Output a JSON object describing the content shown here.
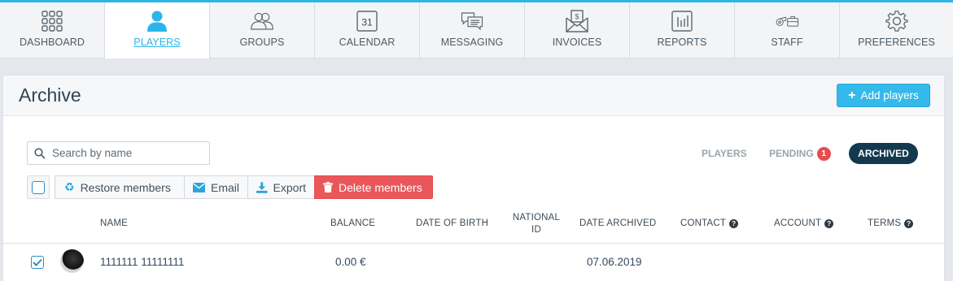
{
  "nav": {
    "items": [
      {
        "label": "DASHBOARD",
        "icon": "dashboard-grid-icon"
      },
      {
        "label": "PLAYERS",
        "icon": "player-person-icon",
        "active": true
      },
      {
        "label": "GROUPS",
        "icon": "groups-people-icon"
      },
      {
        "label": "CALENDAR",
        "icon": "calendar-icon",
        "day": "31"
      },
      {
        "label": "MESSAGING",
        "icon": "chat-bubbles-icon"
      },
      {
        "label": "INVOICES",
        "icon": "invoice-envelope-icon"
      },
      {
        "label": "REPORTS",
        "icon": "bar-chart-icon"
      },
      {
        "label": "STAFF",
        "icon": "whistle-briefcase-icon"
      },
      {
        "label": "PREFERENCES",
        "icon": "gear-icon"
      }
    ],
    "accent_color": "#2cb5e8"
  },
  "page": {
    "title": "Archive",
    "add_button": "Add players"
  },
  "search": {
    "placeholder": "Search by name"
  },
  "filters": {
    "players": "PLAYERS",
    "pending": "PENDING",
    "pending_count": "1",
    "archived": "ARCHIVED"
  },
  "actions": {
    "restore": "Restore members",
    "email": "Email",
    "export": "Export",
    "delete": "Delete members",
    "delete_color": "#e9575a"
  },
  "table": {
    "headers": {
      "name": "NAME",
      "balance": "BALANCE",
      "dob": "DATE OF BIRTH",
      "national_id_1": "NATIONAL",
      "national_id_2": "ID",
      "date_archived": "DATE ARCHIVED",
      "contact": "CONTACT",
      "account": "ACCOUNT",
      "terms": "TERMS",
      "help_glyph": "?"
    },
    "rows": [
      {
        "checked": true,
        "name": "1111111 11111111",
        "balance": "0.00 €",
        "dob": "",
        "national_id": "",
        "date_archived": "07.06.2019"
      }
    ]
  }
}
